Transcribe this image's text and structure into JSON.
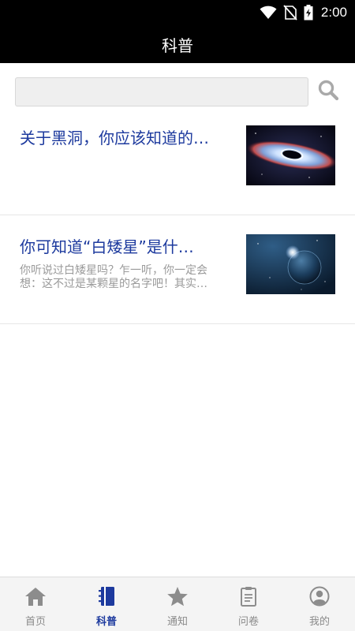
{
  "status_bar": {
    "time": "2:00"
  },
  "header": {
    "title": "科普"
  },
  "search": {
    "value": "",
    "placeholder": ""
  },
  "articles": [
    {
      "title": "关于黑洞，你应该知道的…",
      "summary": ""
    },
    {
      "title": "你可知道“白矮星”是什…",
      "summary": "你听说过白矮星吗？乍一听，你一定会想：这不过是某颗星的名字吧！其实…"
    }
  ],
  "tabs": [
    {
      "label": "首页",
      "icon": "home-icon",
      "active": false
    },
    {
      "label": "科普",
      "icon": "notebook-icon",
      "active": true
    },
    {
      "label": "通知",
      "icon": "star-icon",
      "active": false
    },
    {
      "label": "问卷",
      "icon": "clipboard-icon",
      "active": false
    },
    {
      "label": "我的",
      "icon": "user-icon",
      "active": false
    }
  ],
  "colors": {
    "accent": "#1d3a9e",
    "inactive": "#8a8a8a",
    "header_bg": "#000000"
  }
}
